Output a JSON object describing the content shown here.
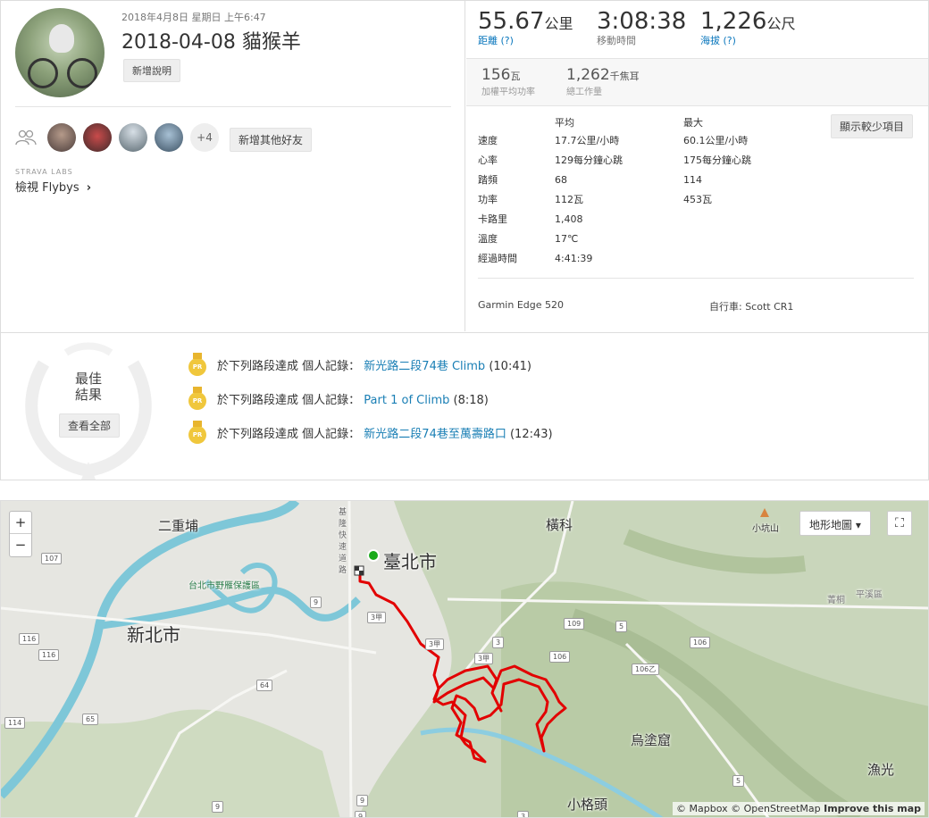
{
  "activity": {
    "datetime": "2018年4月8日 星期日 上午6:47",
    "title": "2018-04-08 貓猴羊",
    "add_description": "新增說明",
    "add_friends": "新增其他好友",
    "more_friends": "+4",
    "labs_label": "STRAVA LABS",
    "flybys": "檢視 Flybys"
  },
  "stats": {
    "distance": {
      "value": "55.67",
      "unit": "公里",
      "label": "距離 (?)"
    },
    "moving_time": {
      "value": "3:08:38",
      "label": "移動時間"
    },
    "elevation": {
      "value": "1,226",
      "unit": "公尺",
      "label": "海拔 (?)"
    },
    "weighted_power": {
      "value": "156",
      "unit": "瓦",
      "label": "加權平均功率"
    },
    "total_work": {
      "value": "1,262",
      "unit": "千焦耳",
      "label": "總工作量"
    }
  },
  "detail": {
    "header_avg": "平均",
    "header_max": "最大",
    "toggle_button": "顯示較少項目",
    "rows": [
      {
        "label": "速度",
        "avg": "17.7公里/小時",
        "max": "60.1公里/小時"
      },
      {
        "label": "心率",
        "avg": "129每分鐘心跳",
        "max": "175每分鐘心跳"
      },
      {
        "label": "踏頻",
        "avg": "68",
        "max": "114"
      },
      {
        "label": "功率",
        "avg": "112瓦",
        "max": "453瓦"
      },
      {
        "label": "卡路里",
        "avg": "1,408",
        "max": ""
      },
      {
        "label": "溫度",
        "avg": "17℃",
        "max": ""
      },
      {
        "label": "經過時間",
        "avg": "4:41:39",
        "max": ""
      }
    ],
    "device": "Garmin Edge 520",
    "bike": "自行車: Scott CR1"
  },
  "achievements": {
    "title_line1": "最佳",
    "title_line2": "結果",
    "view_all": "查看全部",
    "medal_text": "PR",
    "items": [
      {
        "prefix": "於下列路段達成 ",
        "kind": "個人記錄",
        "sep": "： ",
        "segment": "新光路二段74巷 Climb",
        "time": " (10:41)"
      },
      {
        "prefix": "於下列路段達成 ",
        "kind": "個人記錄",
        "sep": "： ",
        "segment": "Part 1 of Climb",
        "time": " (8:18)"
      },
      {
        "prefix": "於下列路段達成 ",
        "kind": "個人記錄",
        "sep": "： ",
        "segment": "新光路二段74巷至萬壽路口",
        "time": " (12:43)"
      }
    ]
  },
  "map": {
    "zoom_in": "+",
    "zoom_out": "−",
    "map_type": "地形地圖 ▾",
    "fullscreen": "⛶",
    "attrib_mapbox": "© Mapbox",
    "attrib_osm": "© OpenStreetMap",
    "attrib_improve": "Improve this map",
    "labels": {
      "sanchong": "二重埔",
      "taipei": "臺北市",
      "xinbei": "新北市",
      "hengke": "橫科",
      "wutuku": "烏塗窟",
      "yuguang": "漁光",
      "xiaogetou": "小格頭",
      "xiaokengshan": "小坑山",
      "pingxi": "平溪區",
      "shuangxi": "菁桐",
      "wildbird": "台北市野雁保護區",
      "route_line": "基隆快速道路"
    },
    "roads": [
      "107",
      "116",
      "116",
      "114",
      "65",
      "64",
      "9",
      "9",
      "3甲",
      "3甲",
      "3甲",
      "3",
      "106",
      "106",
      "106乙",
      "109",
      "5",
      "5",
      "9",
      "9",
      "3"
    ]
  },
  "colors": {
    "route": "#e20000",
    "link": "#0a77bd",
    "medal": "#f0c73c",
    "start": "#1aaa1a"
  }
}
